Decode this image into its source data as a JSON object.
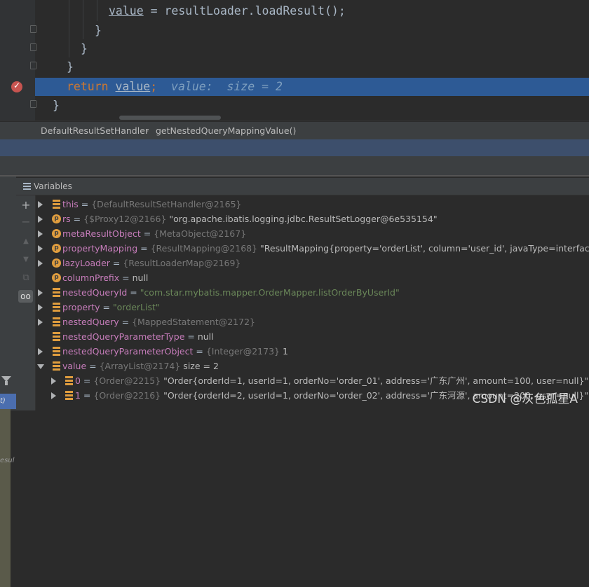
{
  "editor": {
    "lines": [
      {
        "pre": "        ",
        "a": "value",
        "b": " = resultLoader.loadResult();"
      },
      {
        "pre": "      ",
        "text": "}"
      },
      {
        "pre": "    ",
        "text": "}"
      },
      {
        "pre": "  ",
        "text": "}"
      },
      {
        "kw": "return",
        "var": "value",
        "semi": ";",
        "hint": "value:  size = 2"
      },
      {
        "pre": "",
        "text": "}"
      }
    ]
  },
  "breadcrumb": {
    "class": "DefaultResultSetHandler",
    "method": "getNestedQueryMappingValue()",
    "separator": "›"
  },
  "frames": {
    "selected": "t)",
    "item": "esul"
  },
  "variables": {
    "title": "Variables",
    "toolbar": {
      "add": "+",
      "remove": "−",
      "up": "▲",
      "down": "▼",
      "copy": "⧉",
      "glasses": "oo"
    },
    "rows": [
      {
        "name": "this",
        "eq": " = ",
        "type": "{DefaultResultSetHandler@2165}",
        "value": ""
      },
      {
        "name": "rs",
        "eq": " = ",
        "type": "{$Proxy12@2166}",
        "value": " \"org.apache.ibatis.logging.jdbc.ResultSetLogger@6e535154\""
      },
      {
        "name": "metaResultObject",
        "eq": " = ",
        "type": "{MetaObject@2167}",
        "value": ""
      },
      {
        "name": "propertyMapping",
        "eq": " = ",
        "type": "{ResultMapping@2168}",
        "value": " \"ResultMapping{property='orderList', column='user_id', javaType=interface java.util.L"
      },
      {
        "name": "lazyLoader",
        "eq": " = ",
        "type": "{ResultLoaderMap@2169}",
        "value": ""
      },
      {
        "name": "columnPrefix",
        "eq": " = ",
        "type": "",
        "value": "null"
      },
      {
        "name": "nestedQueryId",
        "eq": " = ",
        "type": "",
        "str": "\"com.star.mybatis.mapper.OrderMapper.listOrderByUserId\""
      },
      {
        "name": "property",
        "eq": " = ",
        "type": "",
        "str": "\"orderList\""
      },
      {
        "name": "nestedQuery",
        "eq": " = ",
        "type": "{MappedStatement@2172}",
        "value": ""
      },
      {
        "name": "nestedQueryParameterType",
        "eq": " = ",
        "type": "",
        "value": "null"
      },
      {
        "name": "nestedQueryParameterObject",
        "eq": " = ",
        "type": "{Integer@2173}",
        "value": " 1"
      },
      {
        "name": "value",
        "eq": " = ",
        "type": "{ArrayList@2174}",
        "value": "  size = 2"
      },
      {
        "name": "0",
        "eq": " = ",
        "type": "{Order@2215}",
        "value": " \"Order{orderId=1, userId=1, orderNo='order_01', address='广东广州', amount=100, user=null}\""
      },
      {
        "name": "1",
        "eq": " = ",
        "type": "{Order@2216}",
        "value": " \"Order{orderId=2, userId=1, orderNo='order_02', address='广东河源', amount=200, user=null}\""
      }
    ]
  },
  "watermark": "CSDN @灰色孤星A"
}
